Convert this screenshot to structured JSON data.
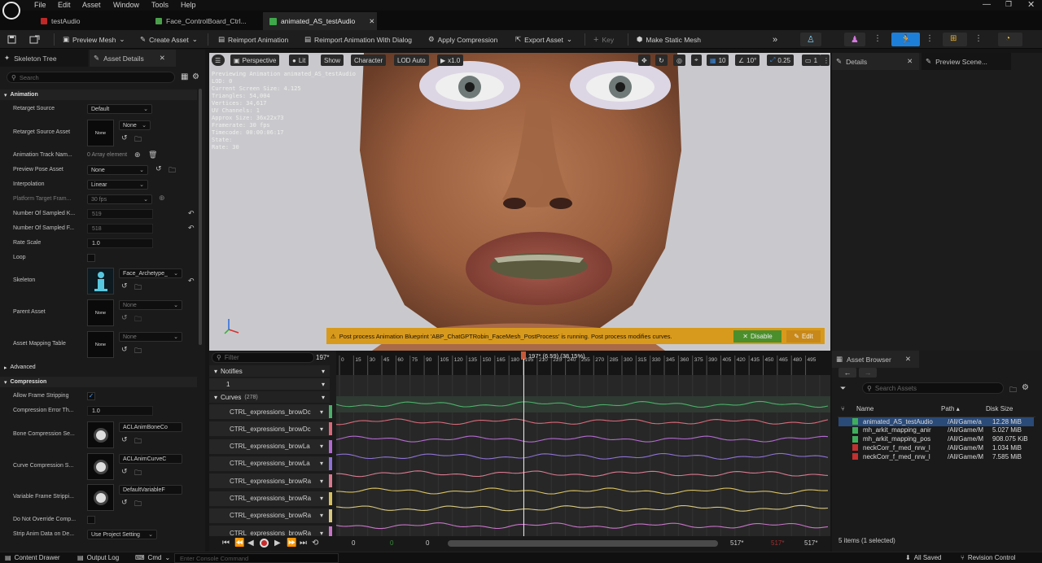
{
  "menu": [
    "File",
    "Edit",
    "Asset",
    "Window",
    "Tools",
    "Help"
  ],
  "tabs": [
    {
      "label": "testAudio"
    },
    {
      "label": "Face_ControlBoard_Ctrl..."
    },
    {
      "label": "animated_AS_testAudio"
    }
  ],
  "toolbar": {
    "preview_mesh": "Preview Mesh",
    "create_asset": "Create Asset",
    "reimport": "Reimport Animation",
    "reimport_dialog": "Reimport Animation With Dialog",
    "apply_compression": "Apply Compression",
    "export_asset": "Export Asset",
    "key": "Key",
    "make_static_mesh": "Make Static Mesh"
  },
  "left_panel": {
    "tab_skeleton": "Skeleton Tree",
    "tab_details": "Asset Details",
    "search_placeholder": "Search",
    "sections": {
      "animation": "Animation",
      "advanced": "Advanced",
      "compression": "Compression"
    },
    "props": {
      "retarget_source": "Retarget Source",
      "retarget_source_value": "Default",
      "retarget_source_asset": "Retarget Source Asset",
      "none": "None",
      "animation_track_names": "Animation Track Nam...",
      "array_element": "0 Array element",
      "preview_pose_asset": "Preview Pose Asset",
      "interpolation": "Interpolation",
      "interpolation_value": "Linear",
      "platform_target_frame": "Platform Target Fram...",
      "fps_value": "30 fps",
      "num_sampled_keys": "Number Of Sampled K...",
      "num_sampled_keys_value": "519",
      "num_sampled_frames": "Number Of Sampled F...",
      "num_sampled_frames_value": "518",
      "rate_scale": "Rate Scale",
      "rate_scale_value": "1.0",
      "loop": "Loop",
      "skeleton": "Skeleton",
      "skeleton_value": "Face_Archetype_",
      "parent_asset": "Parent Asset",
      "asset_mapping_table": "Asset Mapping Table",
      "allow_frame_stripping": "Allow Frame Stripping",
      "compression_error_threshold": "Compression Error Th...",
      "compression_error_value": "1.0",
      "bone_compression": "Bone Compression Se...",
      "bone_compression_value": "ACLAnimBoneCo",
      "curve_compression": "Curve Compression S...",
      "curve_compression_value": "ACLAnimCurveC",
      "variable_frame": "Variable Frame Strippi...",
      "variable_frame_value": "DefaultVariableF",
      "do_not_override": "Do Not Override Comp...",
      "strip_anim_data": "Strip Anim Data on De...",
      "strip_anim_value": "Use Project Setting"
    }
  },
  "viewport": {
    "perspective": "Perspective",
    "lit": "Lit",
    "show": "Show",
    "character": "Character",
    "lod": "LOD Auto",
    "speed": "x1.0",
    "grid": "10",
    "angle": "10°",
    "scale": "0.25",
    "cams": "1",
    "stats": [
      "Previewing Animation animated_AS_testAudio",
      "LOD: 0",
      "Current Screen Size: 4.125",
      "Triangles: 54,004",
      "Vertices: 34,617",
      "UV Channels: 1",
      "Approx Size: 36x22x73",
      "Framerate: 30 fps",
      "Timecode: 00:00:06:17",
      "State:",
      "Rate: 30"
    ],
    "banner_text": "Post process Animation Blueprint 'ABP_ChatGPTRobin_FaceMesh_PostProcess' is running. Post process modifies curves.",
    "disable_label": "Disable",
    "edit_label": "Edit"
  },
  "timeline": {
    "filter_placeholder": "Filter",
    "frame_count": "197",
    "playhead_label": "197* (6.59) (38.15%)",
    "notifies": "Notifies",
    "notifies_track": "1",
    "curves_label": "Curves",
    "curves_count": "(278)",
    "ruler": [
      "0",
      "15",
      "30",
      "45",
      "60",
      "75",
      "90",
      "105",
      "120",
      "135",
      "150",
      "165",
      "180",
      "195",
      "210",
      "225",
      "240",
      "255",
      "270",
      "285",
      "300",
      "315",
      "330",
      "345",
      "360",
      "375",
      "390",
      "405",
      "420",
      "435",
      "450",
      "465",
      "480",
      "495"
    ],
    "tracks": [
      {
        "name": "CTRL_expressions_browDc",
        "color": "#4caf6a"
      },
      {
        "name": "CTRL_expressions_browDc",
        "color": "#d86a7a"
      },
      {
        "name": "CTRL_expressions_browLa",
        "color": "#b36ad0"
      },
      {
        "name": "CTRL_expressions_browLa",
        "color": "#8e72d6"
      },
      {
        "name": "CTRL_expressions_browRa",
        "color": "#d97a90"
      },
      {
        "name": "CTRL_expressions_browRa",
        "color": "#d8c060"
      },
      {
        "name": "CTRL_expressions_browRa",
        "color": "#d8c880"
      },
      {
        "name": "CTRL_expressions_browRa",
        "color": "#c874c8"
      }
    ],
    "range_start": "0",
    "range_mid": "0",
    "range_end_a": "517*",
    "range_end_b": "517*"
  },
  "right_panel": {
    "tab_details": "Details",
    "tab_preview": "Preview Scene..."
  },
  "asset_browser": {
    "title": "Asset Browser",
    "search_placeholder": "Search Assets",
    "col_name": "Name",
    "col_path": "Path",
    "col_size": "Disk Size",
    "rows": [
      {
        "name": "animated_AS_testAudio",
        "path": "/All/Game/a",
        "size": "12.28 MiB",
        "color": "#3fae5a"
      },
      {
        "name": "mh_arkit_mapping_anir",
        "path": "/All/Game/M",
        "size": "5.027 MiB",
        "color": "#3fae5a"
      },
      {
        "name": "mh_arkit_mapping_pos",
        "path": "/All/Game/M",
        "size": "908.075 KiB",
        "color": "#3fae5a"
      },
      {
        "name": "neckCorr_f_med_nrw_l",
        "path": "/All/Game/M",
        "size": "1.034 MiB",
        "color": "#c23030"
      },
      {
        "name": "neckCorr_f_med_nrw_l",
        "path": "/All/Game/M",
        "size": "7.585 MiB",
        "color": "#c23030"
      }
    ],
    "items_summary": "5 items (1 selected)"
  },
  "statusbar": {
    "content_drawer": "Content Drawer",
    "output_log": "Output Log",
    "cmd": "Cmd",
    "console_placeholder": "Enter Console Command",
    "all_saved": "All Saved",
    "revision_control": "Revision Control"
  }
}
